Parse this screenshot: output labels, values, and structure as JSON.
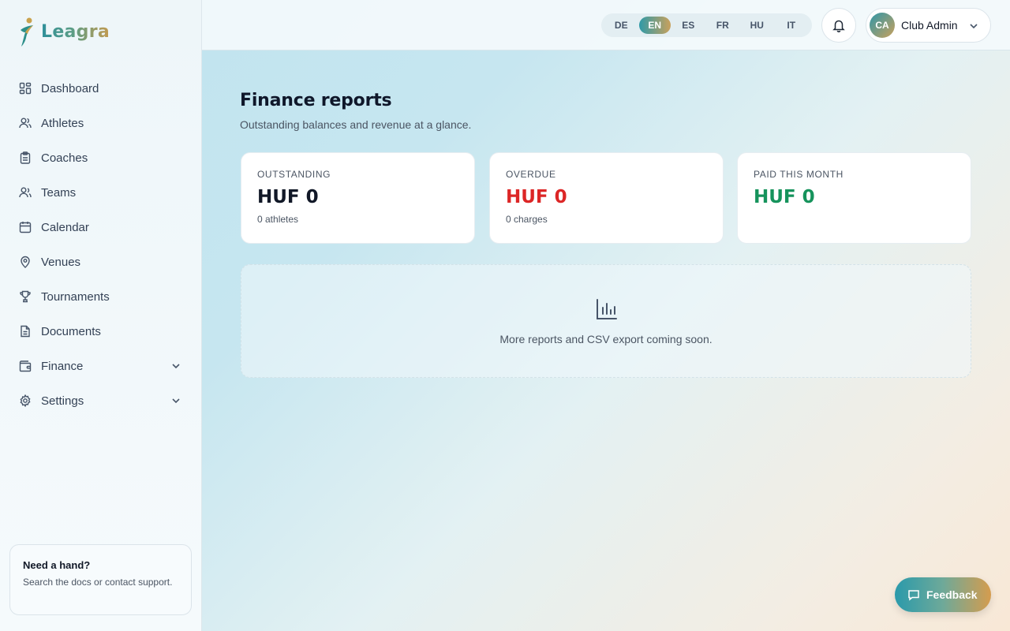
{
  "brand": {
    "name": "Leagra"
  },
  "sidebar": {
    "items": [
      {
        "label": "Dashboard",
        "icon": "dashboard-icon"
      },
      {
        "label": "Athletes",
        "icon": "users-icon"
      },
      {
        "label": "Coaches",
        "icon": "clipboard-icon"
      },
      {
        "label": "Teams",
        "icon": "team-icon"
      },
      {
        "label": "Calendar",
        "icon": "calendar-icon"
      },
      {
        "label": "Venues",
        "icon": "map-pin-icon"
      },
      {
        "label": "Tournaments",
        "icon": "trophy-icon"
      },
      {
        "label": "Documents",
        "icon": "document-icon"
      },
      {
        "label": "Finance",
        "icon": "wallet-icon"
      },
      {
        "label": "Settings",
        "icon": "gear-icon"
      }
    ],
    "help": {
      "title": "Need a hand?",
      "text": "Search the docs or contact support."
    }
  },
  "topbar": {
    "languages": [
      "DE",
      "EN",
      "ES",
      "FR",
      "HU",
      "IT"
    ],
    "active_language": "EN",
    "user": {
      "initials": "CA",
      "name": "Club Admin"
    }
  },
  "main": {
    "title": "Finance reports",
    "subtitle": "Outstanding balances and revenue at a glance.",
    "cards": [
      {
        "label": "OUTSTANDING",
        "value": "HUF 0",
        "sub": "0 athletes",
        "color": "#111827"
      },
      {
        "label": "OVERDUE",
        "value": "HUF 0",
        "sub": "0 charges",
        "color": "#dc2626"
      },
      {
        "label": "PAID THIS MONTH",
        "value": "HUF 0",
        "sub": "",
        "color": "#16935c"
      }
    ],
    "empty_state": {
      "text": "More reports and CSV export coming soon."
    }
  },
  "feedback": {
    "label": "Feedback"
  },
  "colors": {
    "accent_start": "#2a9aab",
    "accent_end": "#d59c4e"
  }
}
